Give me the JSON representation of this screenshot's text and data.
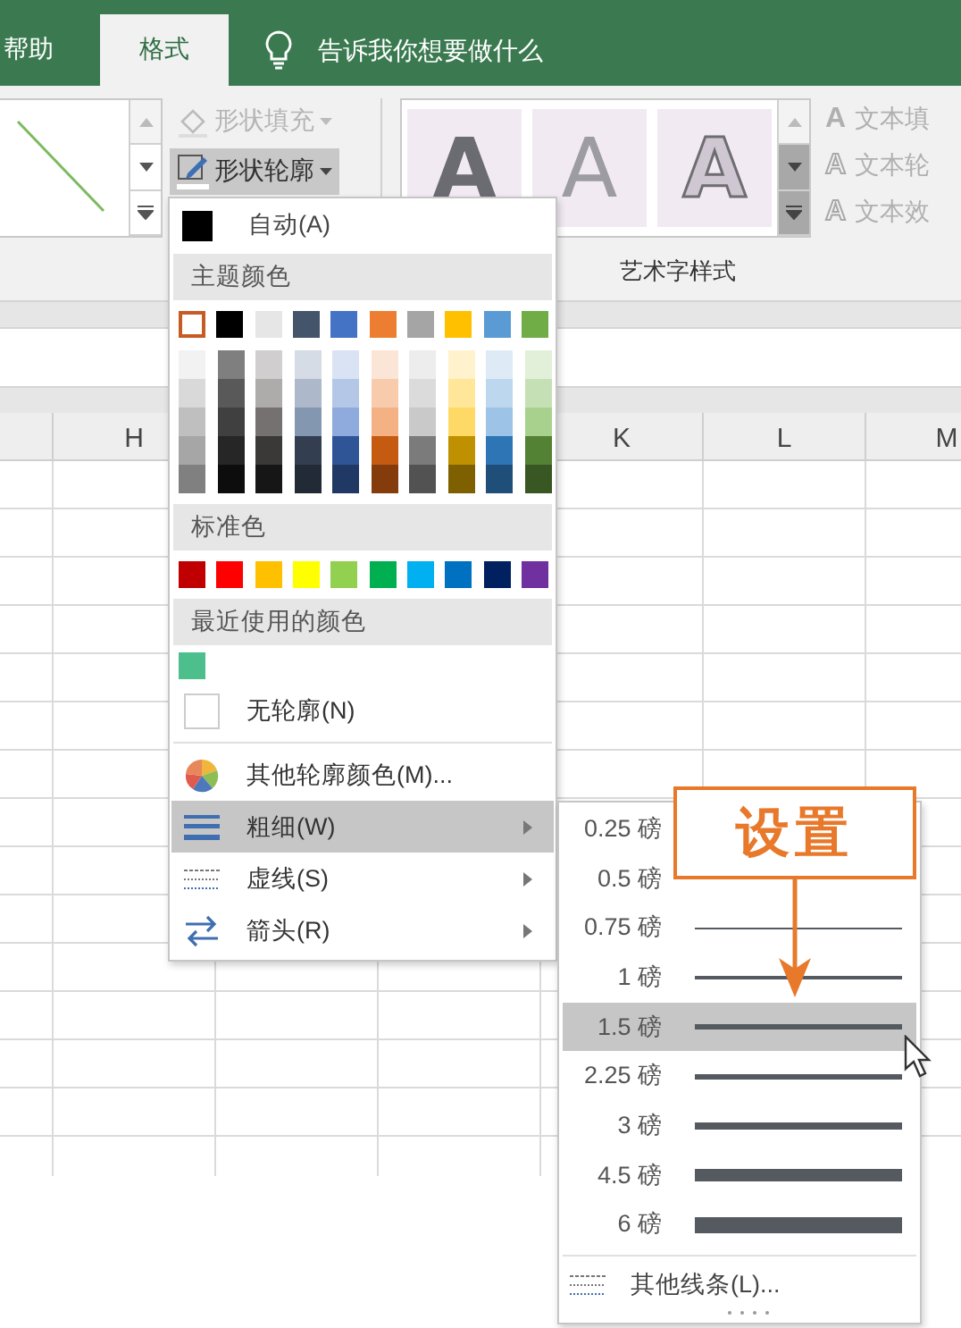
{
  "ribbon_tabs": [
    {
      "label": "帮助",
      "selected": false
    },
    {
      "label": "格式",
      "selected": true
    }
  ],
  "tell_me": {
    "placeholder": "告诉我你想要做什么"
  },
  "ribbon": {
    "shape_fill": {
      "label": "形状填充",
      "disabled": true
    },
    "shape_outline": {
      "label": "形状轮廓",
      "pressed": true
    },
    "wordart_gallery": [
      {
        "kind": "solid",
        "letter": "A"
      },
      {
        "kind": "soft",
        "letter": "A"
      },
      {
        "kind": "outline",
        "letter": "A"
      }
    ],
    "text_buttons": [
      {
        "icon": "A",
        "label": "文本填",
        "disabled": true
      },
      {
        "icon": "A",
        "label": "文本轮",
        "disabled": true
      },
      {
        "icon": "A",
        "label": "文本效",
        "disabled": true
      }
    ],
    "group_label": "艺术字样式"
  },
  "columns": [
    "H",
    "K",
    "L",
    "M"
  ],
  "outline_menu": {
    "automatic": {
      "label": "自动(A)",
      "color": "#000000"
    },
    "theme_header": "主题颜色",
    "theme_colors": [
      {
        "color": "#ffffff",
        "selected": true,
        "shades": [
          {
            "color": "#f2f2f2"
          },
          {
            "color": "#d9d9d9"
          },
          {
            "color": "#bfbfbf"
          },
          {
            "color": "#a6a6a6"
          },
          {
            "color": "#808080"
          }
        ]
      },
      {
        "color": "#000000",
        "selected": false,
        "shades": [
          {
            "color": "#7f7f7f"
          },
          {
            "color": "#595959"
          },
          {
            "color": "#404040"
          },
          {
            "color": "#262626"
          },
          {
            "color": "#0d0d0d"
          }
        ]
      },
      {
        "color": "#e7e6e6",
        "selected": false,
        "shades": [
          {
            "color": "#d0cece"
          },
          {
            "color": "#aeabab"
          },
          {
            "color": "#767171"
          },
          {
            "color": "#3b3838"
          },
          {
            "color": "#171616"
          }
        ]
      },
      {
        "color": "#44546a",
        "selected": false,
        "shades": [
          {
            "color": "#d6dce5"
          },
          {
            "color": "#adb9ca"
          },
          {
            "color": "#8497b0"
          },
          {
            "color": "#333f50"
          },
          {
            "color": "#222a35"
          }
        ]
      },
      {
        "color": "#4472c4",
        "selected": false,
        "shades": [
          {
            "color": "#dae3f3"
          },
          {
            "color": "#b4c7e7"
          },
          {
            "color": "#8faadc"
          },
          {
            "color": "#2f5597"
          },
          {
            "color": "#203864"
          }
        ]
      },
      {
        "color": "#ed7d31",
        "selected": false,
        "shades": [
          {
            "color": "#fbe5d6"
          },
          {
            "color": "#f8cbad"
          },
          {
            "color": "#f4b183"
          },
          {
            "color": "#c55a11"
          },
          {
            "color": "#843c0c"
          }
        ]
      },
      {
        "color": "#a5a5a5",
        "selected": false,
        "shades": [
          {
            "color": "#ededed"
          },
          {
            "color": "#dbdbdb"
          },
          {
            "color": "#c9c9c9"
          },
          {
            "color": "#7b7b7b"
          },
          {
            "color": "#525252"
          }
        ]
      },
      {
        "color": "#ffc000",
        "selected": false,
        "shades": [
          {
            "color": "#fff2cc"
          },
          {
            "color": "#ffe699"
          },
          {
            "color": "#ffd966"
          },
          {
            "color": "#bf9000"
          },
          {
            "color": "#7f6000"
          }
        ]
      },
      {
        "color": "#5b9bd5",
        "selected": false,
        "shades": [
          {
            "color": "#deebf7"
          },
          {
            "color": "#bdd7ee"
          },
          {
            "color": "#9dc3e6"
          },
          {
            "color": "#2e75b6"
          },
          {
            "color": "#1f4e79"
          }
        ]
      },
      {
        "color": "#70ad47",
        "selected": false,
        "shades": [
          {
            "color": "#e2f0d9"
          },
          {
            "color": "#c5e0b4"
          },
          {
            "color": "#a9d18e"
          },
          {
            "color": "#548235"
          },
          {
            "color": "#385723"
          }
        ]
      }
    ],
    "standard_header": "标准色",
    "standard_colors": [
      {
        "color": "#c00000"
      },
      {
        "color": "#ff0000"
      },
      {
        "color": "#ffc000"
      },
      {
        "color": "#ffff00"
      },
      {
        "color": "#92d050"
      },
      {
        "color": "#00b050"
      },
      {
        "color": "#00b0f0"
      },
      {
        "color": "#0070c0"
      },
      {
        "color": "#002060"
      },
      {
        "color": "#7030a0"
      }
    ],
    "recent_header": "最近使用的颜色",
    "recent_colors": [
      {
        "color": "#4cbf8c"
      }
    ],
    "items": [
      {
        "kind": "none",
        "label": "无轮廓(N)",
        "selected": false,
        "has_submenu": false
      },
      {
        "kind": "palette",
        "label": "其他轮廓颜色(M)...",
        "selected": false,
        "has_submenu": false
      },
      {
        "kind": "weight",
        "label": "粗细(W)",
        "selected": true,
        "has_submenu": true
      },
      {
        "kind": "dash",
        "label": "虚线(S)",
        "selected": false,
        "has_submenu": true
      },
      {
        "kind": "arrow",
        "label": "箭头(R)",
        "selected": false,
        "has_submenu": true
      }
    ]
  },
  "weight_submenu": {
    "items": [
      {
        "label": "0.25 磅",
        "selected": false
      },
      {
        "label": "0.5 磅",
        "selected": false
      },
      {
        "label": "0.75 磅",
        "selected": false
      },
      {
        "label": "1 磅",
        "selected": false
      },
      {
        "label": "1.5 磅",
        "selected": true
      },
      {
        "label": "2.25 磅",
        "selected": false
      },
      {
        "label": "3 磅",
        "selected": false
      },
      {
        "label": "4.5 磅",
        "selected": false
      },
      {
        "label": "6 磅",
        "selected": false
      }
    ],
    "more": {
      "label": "其他线条(L)..."
    }
  },
  "callout": {
    "text": "设置"
  }
}
